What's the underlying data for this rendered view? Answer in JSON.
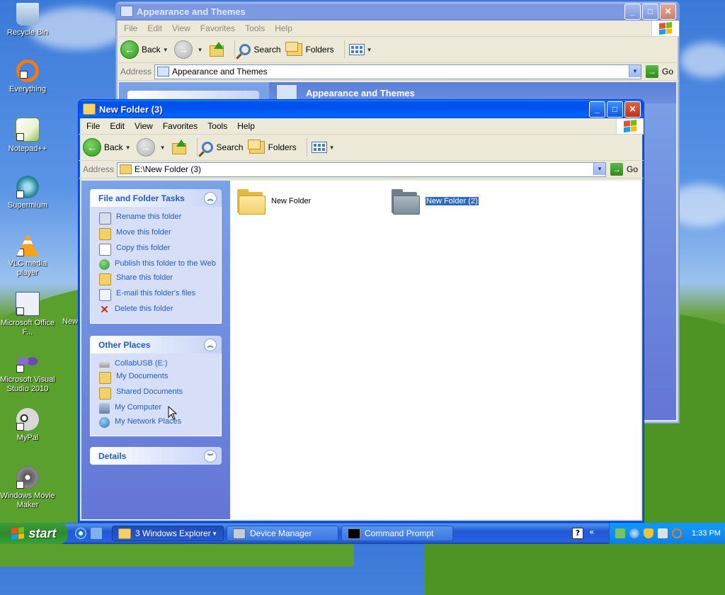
{
  "desktop": {
    "icons": [
      {
        "label": "Recycle Bin"
      },
      {
        "label": "Everything"
      },
      {
        "label": "Notepad++"
      },
      {
        "label": "Supermium"
      },
      {
        "label": "VLC media player"
      },
      {
        "label": "Microsoft Office F..."
      },
      {
        "label": "Microsoft Visual Studio 2010"
      },
      {
        "label": "MyPal"
      },
      {
        "label": "Windows Movie Maker"
      }
    ],
    "partial_label": "New"
  },
  "back_window": {
    "title": "Appearance and Themes",
    "menu": [
      "File",
      "Edit",
      "View",
      "Favorites",
      "Tools",
      "Help"
    ],
    "toolbar": {
      "back": "Back",
      "search": "Search",
      "folders": "Folders"
    },
    "address_label": "Address",
    "address_value": "Appearance and Themes",
    "go": "Go",
    "heading": "Appearance and Themes"
  },
  "front_window": {
    "title": "New Folder (3)",
    "menu": [
      "File",
      "Edit",
      "View",
      "Favorites",
      "Tools",
      "Help"
    ],
    "toolbar": {
      "back": "Back",
      "search": "Search",
      "folders": "Folders"
    },
    "address_label": "Address",
    "address_value": "E:\\New Folder (3)",
    "go": "Go",
    "tasks_panel": {
      "title": "File and Folder Tasks",
      "links": [
        "Rename this folder",
        "Move this folder",
        "Copy this folder",
        "Publish this folder to the Web",
        "Share this folder",
        "E-mail this folder's files",
        "Delete this folder"
      ]
    },
    "other_places": {
      "title": "Other Places",
      "links": [
        "CollabUSB (E:)",
        "My Documents",
        "Shared Documents",
        "My Computer",
        "My Network Places"
      ]
    },
    "details": {
      "title": "Details"
    },
    "items": [
      {
        "name": "New Folder"
      },
      {
        "name": "New Folder (2)"
      }
    ]
  },
  "taskbar": {
    "start": "start",
    "buttons": [
      "3 Windows Explorer",
      "Device Manager",
      "Command Prompt"
    ],
    "clock": "1:33 PM"
  },
  "colors": {
    "xp_blue": "#0053ee",
    "task_link": "#215dc6",
    "selection": "#316ac5",
    "start_green": "#2d8a2d"
  }
}
